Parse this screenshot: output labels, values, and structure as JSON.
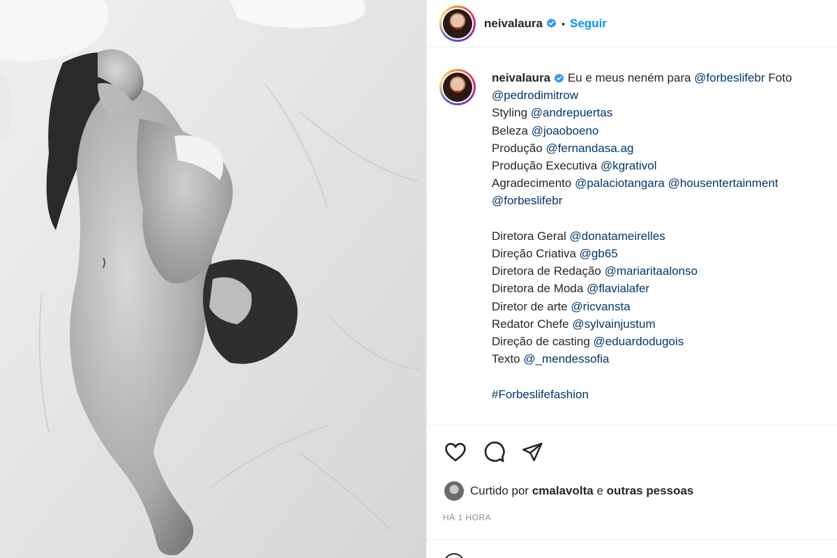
{
  "post": {
    "username": "neivalaura",
    "separator": "•",
    "follow_label": "Seguir",
    "verified_icon": "verified-badge-icon",
    "colors": {
      "accent": "#0095f6",
      "mention": "#00376b",
      "text": "#262626",
      "muted": "#8e8e8e",
      "verified": "#3897f0"
    }
  },
  "caption": {
    "username": "neivalaura",
    "intro": "Eu e meus neném para",
    "intro_mention": "@forbeslifebr",
    "foto_label": "Foto",
    "foto_mention": "@pedrodimitrow",
    "credits_a": [
      {
        "label": "Styling",
        "mention": "@andrepuertas"
      },
      {
        "label": "Beleza",
        "mention": "@joaoboeno"
      },
      {
        "label": "Produção",
        "mention": "@fernandasa.ag"
      },
      {
        "label": "Produção Executiva",
        "mention": "@kgrativol"
      }
    ],
    "agradecimento_label": "Agradecimento",
    "agradecimento_mention_1": "@palaciotangara",
    "agradecimento_mention_2": "@housentertainment",
    "agradecimento_mention_3": "@forbeslifebr",
    "credits_b": [
      {
        "label": "Diretora Geral",
        "mention": "@donatameirelles"
      },
      {
        "label": "Direção Criativa",
        "mention": "@gb65"
      },
      {
        "label": "Diretora de Redação",
        "mention": "@mariaritaalonso"
      },
      {
        "label": "Diretora de Moda",
        "mention": "@flavialafer"
      },
      {
        "label": "Diretor de arte",
        "mention": "@ricvansta"
      },
      {
        "label": "Redator Chefe",
        "mention": "@sylvainjustum"
      },
      {
        "label": "Direção de casting",
        "mention": "@eduardodugois"
      },
      {
        "label": "Texto",
        "mention": "@_mendessofia"
      }
    ],
    "hashtag": "#Forbeslifefashion"
  },
  "actions": {
    "icons": [
      "heart-icon",
      "comment-icon",
      "share-icon"
    ],
    "liked_by_prefix": "Curtido por",
    "liked_by_user": "cmalavolta",
    "liked_by_and": "e",
    "liked_by_others": "outras pessoas",
    "timestamp": "HÁ 1 HORA"
  }
}
